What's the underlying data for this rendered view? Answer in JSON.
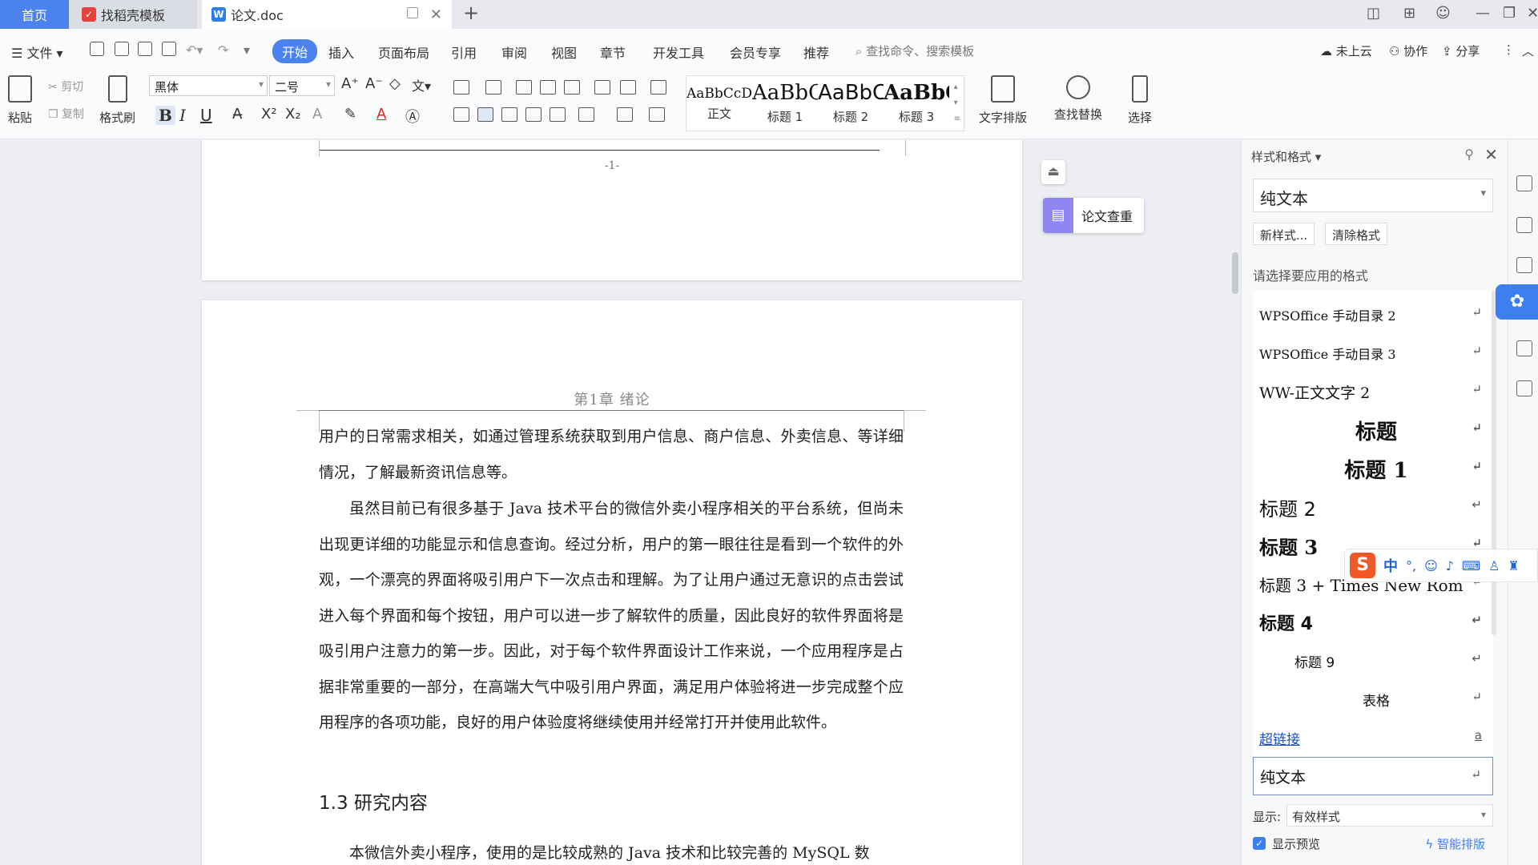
{
  "tabs": {
    "home": "首页",
    "template": "找稻壳模板",
    "doc": "论文.doc"
  },
  "menu": {
    "file": "文件",
    "items": [
      "开始",
      "插入",
      "页面布局",
      "引用",
      "审阅",
      "视图",
      "章节",
      "开发工具",
      "会员专享",
      "推荐"
    ],
    "search_placeholder": "查找命令、搜索模板",
    "cloud": "未上云",
    "collab": "协作",
    "share": "分享"
  },
  "ribbon": {
    "paste": "粘贴",
    "cut": "剪切",
    "copy": "复制",
    "format_painter": "格式刷",
    "font_name": "黑体",
    "font_size": "二号",
    "bold": "B",
    "italic": "I",
    "underline": "U",
    "styles": [
      {
        "sample": "AaBbCcDd",
        "name": "正文"
      },
      {
        "sample": "AaBbC",
        "name": "标题 1"
      },
      {
        "sample": "AaBbC",
        "name": "标题 2"
      },
      {
        "sample": "AaBbC",
        "name": "标题 3"
      }
    ],
    "text_layout": "文字排版",
    "find_replace": "查找替换",
    "select": "选择"
  },
  "document": {
    "prev_page_number": "-1-",
    "header": "第1章 绪论",
    "para1": "用户的日常需求相关，如通过管理系统获取到用户信息、商户信息、外卖信息、等详细情况，了解最新资讯信息等。",
    "para2": "虽然目前已有很多基于 Java 技术平台的微信外卖小程序相关的平台系统，但尚未出现更详细的功能显示和信息查询。经过分析，用户的第一眼往往是看到一个软件的外观，一个漂亮的界面将吸引用户下一次点击和理解。为了让用户通过无意识的点击尝试进入每个界面和每个按钮，用户可以进一步了解软件的质量，因此良好的软件界面将是吸引用户注意力的第一步。因此，对于每个软件界面设计工作来说，一个应用程序是占据非常重要的一部分，在高端大气中吸引用户界面，满足用户体验将进一步完成整个应用程序的各项功能，良好的用户体验度将继续使用并经常打开并使用此软件。",
    "section_heading": "1.3 研究内容",
    "para3": "本微信外卖小程序，使用的是比较成熟的 Java 技术和比较完善的 MySQL 数"
  },
  "paper_check": "论文查重",
  "style_panel": {
    "title": "样式和格式",
    "current_style": "纯文本",
    "new_style": "新样式...",
    "clear_format": "清除格式",
    "prompt": "请选择要应用的格式",
    "items": [
      {
        "label": "WPSOffice 手动目录 2",
        "mark": "↵"
      },
      {
        "label": "WPSOffice 手动目录 3",
        "mark": "↵"
      },
      {
        "label": "WW-正文文字 2",
        "mark": "↵"
      },
      {
        "label": "标题",
        "mark": "↵"
      },
      {
        "label": "标题 1",
        "mark": "↵"
      },
      {
        "label": "标题 2",
        "mark": "↵"
      },
      {
        "label": "标题 3",
        "mark": "↵"
      },
      {
        "label": "标题 3 + Times New Rom",
        "mark": "↵"
      },
      {
        "label": "标题 4",
        "mark": "↵"
      },
      {
        "label": "标题 9",
        "mark": "↵"
      },
      {
        "label": "表格",
        "mark": "↵"
      },
      {
        "label": "超链接",
        "mark": "a"
      },
      {
        "label": "纯文本",
        "mark": "↵"
      }
    ],
    "display_label": "显示:",
    "display_value": "有效样式",
    "show_preview": "显示预览",
    "smart_layout": "智能排版"
  },
  "ime": {
    "mode": "中",
    "punct": "°,"
  },
  "colors": {
    "accent": "#4b82ee",
    "link": "#1a4fc4"
  }
}
